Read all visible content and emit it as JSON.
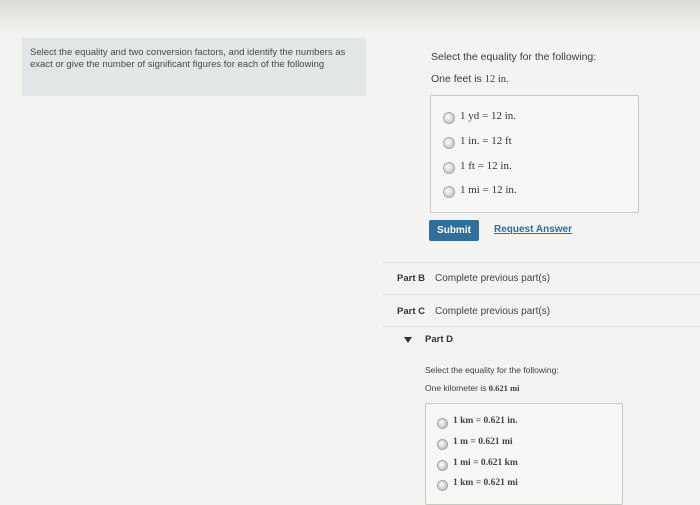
{
  "part_a": {
    "instructions": "Select the equality and two conversion factors, and identify the numbers as exact or give the number of significant figures for each of the following",
    "prompt": "Select the equality for the following:",
    "question_prefix": "One feet is ",
    "question_value": "12 in.",
    "choices": [
      "1 yd = 12 in.",
      "1 in. = 12 ft",
      "1 ft = 12 in.",
      "1 mi = 12 in."
    ],
    "submit_label": "Submit",
    "request_answer_label": "Request Answer"
  },
  "parts": [
    {
      "letter": "Part B",
      "status": "Complete previous part(s)"
    },
    {
      "letter": "Part C",
      "status": "Complete previous part(s)"
    }
  ],
  "part_d": {
    "title": "Part D",
    "prompt": "Select the equality for the following:",
    "question_prefix": "One kilometer is ",
    "question_value": "0.621 mi",
    "choices": [
      "1 km = 0.621 in.",
      "1 m = 0.621 mi",
      "1 mi = 0.621 km",
      "1 km = 0.621 mi"
    ]
  }
}
